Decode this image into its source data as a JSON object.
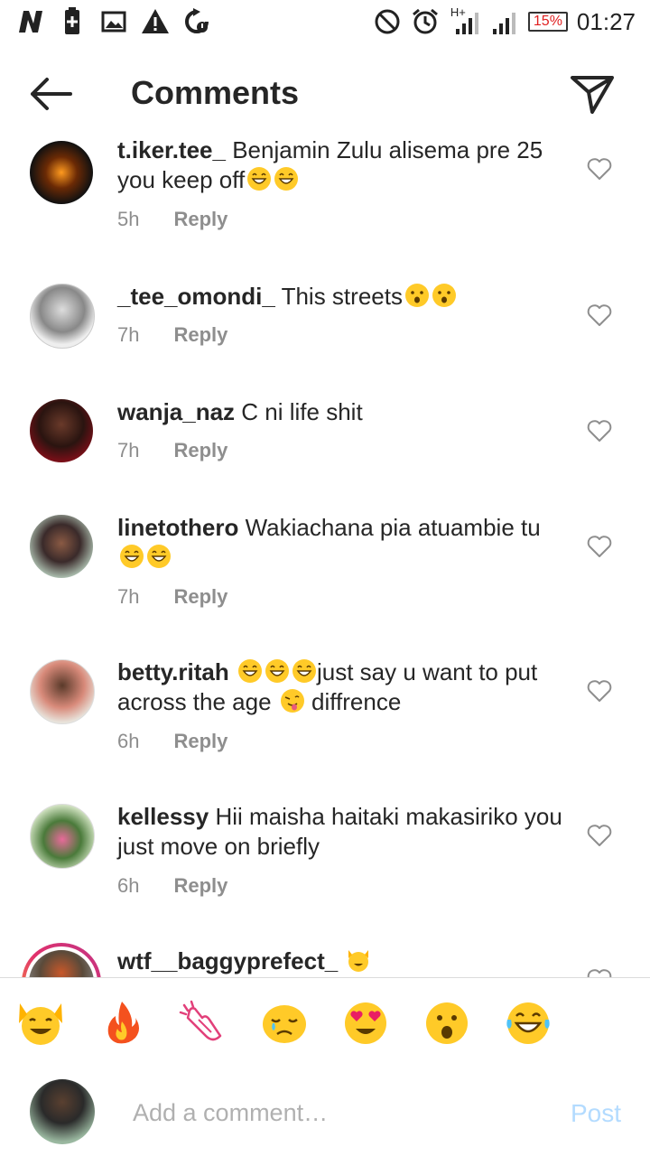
{
  "status_bar": {
    "left_icons": [
      "n-logo-icon",
      "battery-plus-icon",
      "image-icon",
      "warning-icon",
      "sync-icon"
    ],
    "right_icons": [
      "do-not-disturb-icon",
      "alarm-icon",
      "network-hplus-icon",
      "signal-icon"
    ],
    "network_label": "H+",
    "battery": "15%",
    "time": "01:27"
  },
  "header": {
    "title": "Comments"
  },
  "comments": [
    {
      "username": "t.iker.tee_",
      "text": "Benjamin Zulu alisema pre 25 you keep off",
      "emojis": [
        "grinning-sweat",
        "grinning-sweat"
      ],
      "time": "5h",
      "reply": "Reply"
    },
    {
      "username": "_tee_omondi_",
      "text": "This streets",
      "emojis": [
        "hushed",
        "hushed"
      ],
      "time": "7h",
      "reply": "Reply"
    },
    {
      "username": "wanja_naz",
      "text": "C ni life shit",
      "emojis": [],
      "time": "7h",
      "reply": "Reply"
    },
    {
      "username": "linetothero",
      "text": "Wakiachana pia atuambie tu",
      "emojis": [
        "grinning-sweat",
        "grinning-sweat"
      ],
      "time": "7h",
      "reply": "Reply"
    },
    {
      "username": "betty.ritah",
      "text_pre_emojis": [
        "grinning-sweat",
        "grinning-sweat",
        "grinning-sweat"
      ],
      "text": "just say u want to put across the age",
      "text_mid_emoji": "tongue-wink",
      "text_after": "diffrence",
      "time": "6h",
      "reply": "Reply"
    },
    {
      "username": "kellessy",
      "text": "Hii maisha haitaki makasiriko you just move on briefly",
      "emojis": [],
      "time": "6h",
      "reply": "Reply"
    },
    {
      "username": "wtf__baggyprefect_",
      "text": "",
      "emojis": [
        "raised-hands"
      ],
      "time": "",
      "reply": ""
    }
  ],
  "emoji_bar": [
    "raised-hands",
    "fire",
    "clapping-hands",
    "crying-face",
    "heart-eyes",
    "hushed",
    "grinning-sweat"
  ],
  "composer": {
    "placeholder": "Add a comment…",
    "post_label": "Post"
  },
  "colors": {
    "text": "#262626",
    "meta": "#8e8e8e",
    "post_disabled": "#b3dbff",
    "emoji_yellow": "#ffca28",
    "battery_low": "#e02020"
  }
}
